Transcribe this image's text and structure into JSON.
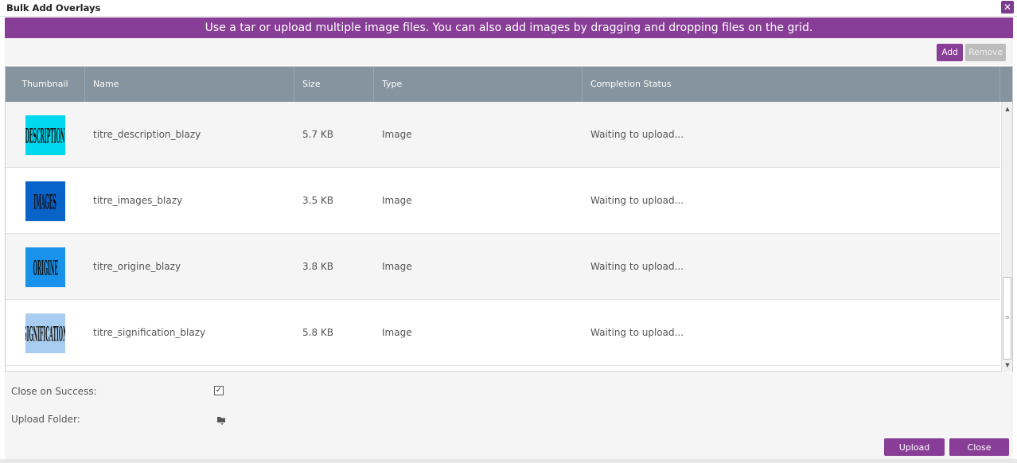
{
  "dialog": {
    "title": "Bulk Add Overlays",
    "close_glyph": "✕",
    "banner": "Use a tar or upload multiple image files. You can also add images by dragging and dropping files on the grid."
  },
  "toolbar": {
    "add_label": "Add",
    "remove_label": "Remove"
  },
  "grid": {
    "columns": [
      "Thumbnail",
      "Name",
      "Size",
      "Type",
      "Completion Status"
    ],
    "rows": [
      {
        "thumb_text": "DESCRIPTION",
        "thumb_color": "#00d8f0",
        "name": "titre_description_blazy",
        "size": "5.7 KB",
        "type": "Image",
        "status": "Waiting to upload..."
      },
      {
        "thumb_text": "IMAGES",
        "thumb_color": "#0a63c9",
        "name": "titre_images_blazy",
        "size": "3.5 KB",
        "type": "Image",
        "status": "Waiting to upload..."
      },
      {
        "thumb_text": "ORIGINE",
        "thumb_color": "#1892ea",
        "name": "titre_origine_blazy",
        "size": "3.8 KB",
        "type": "Image",
        "status": "Waiting to upload..."
      },
      {
        "thumb_text": "SIGNIFICATION",
        "thumb_color": "#a8cdf0",
        "name": "titre_signification_blazy",
        "size": "5.8 KB",
        "type": "Image",
        "status": "Waiting to upload..."
      }
    ]
  },
  "footer": {
    "close_on_success_label": "Close on Success:",
    "close_on_success_checked": true,
    "upload_folder_label": "Upload Folder:",
    "upload_label": "Upload",
    "close_label": "Close"
  },
  "colors": {
    "accent": "#883e96",
    "header": "#85949e",
    "disabled": "#bdbdbd"
  },
  "icons": {
    "close": "close-icon",
    "checkbox": "checkmark-icon",
    "folder": "folder-icon",
    "scroll_up": "arrow-up-icon",
    "scroll_down": "arrow-down-icon"
  }
}
